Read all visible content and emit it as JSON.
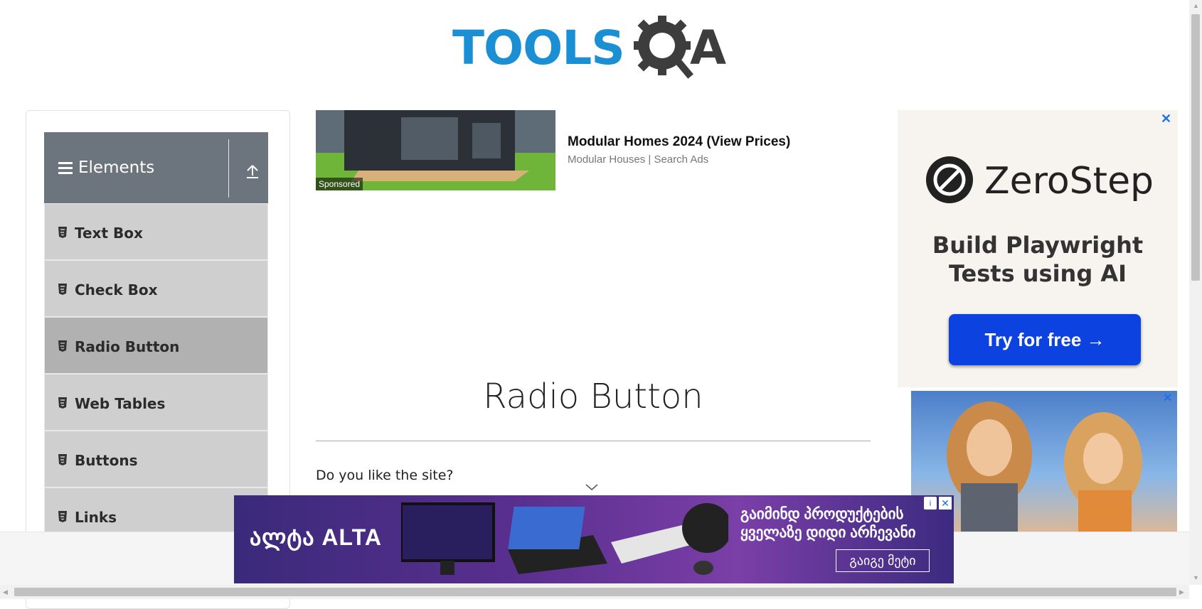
{
  "header": {
    "logo_text": "TOOLS",
    "logo_suffix": "A"
  },
  "sidebar": {
    "group_title": "Elements",
    "items": [
      {
        "label": "Text Box"
      },
      {
        "label": "Check Box"
      },
      {
        "label": "Radio Button",
        "active": true
      },
      {
        "label": "Web Tables"
      },
      {
        "label": "Buttons"
      },
      {
        "label": "Links"
      }
    ]
  },
  "top_ad": {
    "badge": "Sponsored",
    "title": "Modular Homes 2024 (View Prices)",
    "subtitle": "Modular Houses | Search Ads"
  },
  "main": {
    "title": "Radio Button",
    "question": "Do you like the site?"
  },
  "right_ad": {
    "brand": "ZeroStep",
    "tagline_line1": "Build Playwright",
    "tagline_line2": "Tests using AI",
    "cta": "Try for free →",
    "close": "✕"
  },
  "right_ad2": {
    "close": "✕"
  },
  "bottom_ad": {
    "brand": "ალტა ALTA",
    "line1": "გაიმინდ პროდუქტების",
    "line2": "ყველაზე დიდი არჩევანი",
    "cta": "გაიგე მეტი",
    "info": "i",
    "close": "✕"
  }
}
